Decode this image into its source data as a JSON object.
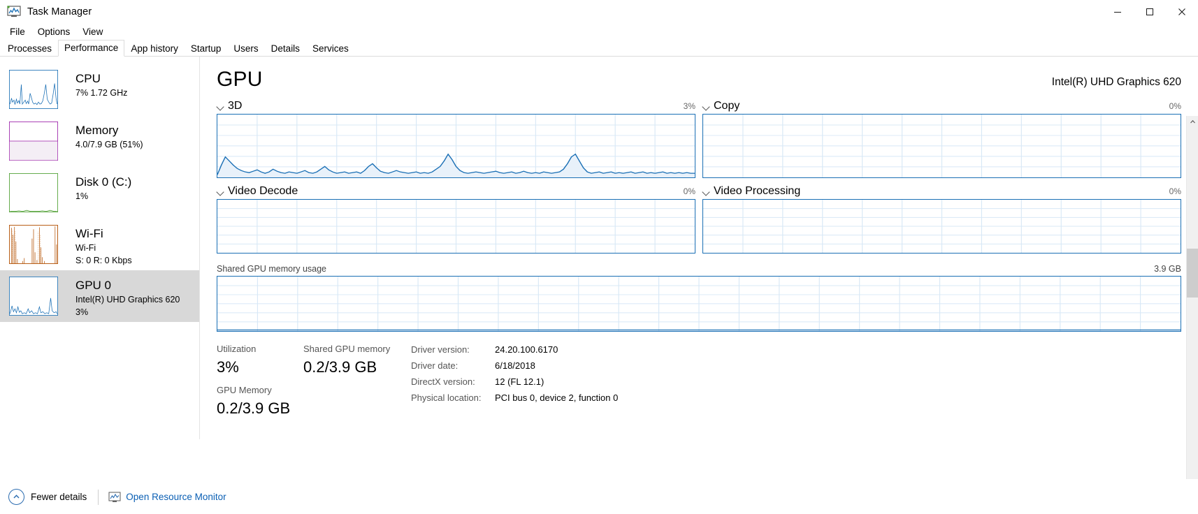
{
  "window": {
    "title": "Task Manager",
    "icon": "task-manager-icon",
    "minimize": "─",
    "maximize": "☐",
    "close": "✕"
  },
  "menu": [
    "File",
    "Options",
    "View"
  ],
  "tabs": [
    {
      "label": "Processes",
      "active": false
    },
    {
      "label": "Performance",
      "active": true
    },
    {
      "label": "App history",
      "active": false
    },
    {
      "label": "Startup",
      "active": false
    },
    {
      "label": "Users",
      "active": false
    },
    {
      "label": "Details",
      "active": false
    },
    {
      "label": "Services",
      "active": false
    }
  ],
  "sidebar": {
    "items": [
      {
        "name": "CPU",
        "title": "CPU",
        "sub1": "7%  1.72 GHz",
        "sub2": "",
        "color": "#1a6fb5",
        "selected": false
      },
      {
        "name": "Memory",
        "title": "Memory",
        "sub1": "4.0/7.9 GB (51%)",
        "sub2": "",
        "color": "#9b1ea8",
        "selected": false
      },
      {
        "name": "Disk 0 (C:)",
        "title": "Disk 0 (C:)",
        "sub1": "1%",
        "sub2": "",
        "color": "#4a9c2d",
        "selected": false
      },
      {
        "name": "Wi-Fi",
        "title": "Wi-Fi",
        "sub1": "Wi-Fi",
        "sub2": "S: 0 R: 0 Kbps",
        "color": "#b85c14",
        "selected": false
      },
      {
        "name": "GPU 0",
        "title": "GPU 0",
        "sub1": "Intel(R) UHD Graphics 620",
        "sub2": "3%",
        "color": "#1a6fb5",
        "selected": true
      }
    ]
  },
  "main": {
    "heading": "GPU",
    "device": "Intel(R) UHD Graphics 620",
    "engines": [
      {
        "label": "3D",
        "percent": "3%"
      },
      {
        "label": "Copy",
        "percent": "0%"
      },
      {
        "label": "Video Decode",
        "percent": "0%"
      },
      {
        "label": "Video Processing",
        "percent": "0%"
      }
    ],
    "memory_graph": {
      "label": "Shared GPU memory usage",
      "max": "3.9 GB"
    },
    "stats": [
      {
        "label": "Utilization",
        "value": "3%"
      },
      {
        "label": "Shared GPU memory",
        "value": "0.2/3.9 GB"
      },
      {
        "label": "GPU Memory",
        "value": "0.2/3.9 GB"
      }
    ],
    "info": [
      {
        "key": "Driver version:",
        "value": "24.20.100.6170"
      },
      {
        "key": "Driver date:",
        "value": "6/18/2018"
      },
      {
        "key": "DirectX version:",
        "value": "12 (FL 12.1)"
      },
      {
        "key": "Physical location:",
        "value": "PCI bus 0, device 2, function 0"
      }
    ]
  },
  "footer": {
    "fewer_details": "Fewer details",
    "open_resource_monitor": "Open Resource Monitor"
  },
  "colors": {
    "accent": "#1a6fb5",
    "link": "#0a5fb4",
    "selected_bg": "#d8d8d8",
    "grid": "#cfe3f3"
  },
  "chart_data": [
    {
      "type": "area",
      "title": "3D",
      "ylim": [
        0,
        100
      ],
      "values": [
        0,
        2,
        14,
        22,
        18,
        14,
        10,
        8,
        6,
        5,
        4,
        5,
        6,
        4,
        3,
        4,
        6,
        9,
        7,
        5,
        4,
        3,
        4,
        5,
        4,
        3,
        3,
        4,
        6,
        8,
        7,
        5,
        4,
        3,
        3,
        4,
        5,
        4,
        3,
        4,
        6,
        9,
        12,
        9,
        6,
        4,
        3,
        3,
        4,
        5,
        6,
        5,
        4,
        3,
        3,
        4,
        5,
        4,
        3,
        3,
        4,
        6,
        8,
        10,
        14,
        22,
        18,
        12,
        8,
        5,
        4,
        3,
        3,
        4,
        5,
        4,
        3,
        3,
        4,
        5,
        6,
        5,
        4,
        3,
        3,
        4,
        5,
        4,
        3,
        4,
        5,
        6,
        4,
        3,
        3,
        4,
        5,
        4,
        3,
        3,
        4,
        6,
        8,
        12,
        18,
        22,
        17,
        12,
        8,
        5,
        4,
        3,
        3,
        4,
        5,
        4,
        3,
        3,
        4,
        3
      ]
    },
    {
      "type": "area",
      "title": "Copy",
      "ylim": [
        0,
        100
      ],
      "values": [
        0,
        0,
        0,
        0,
        0,
        0,
        0,
        0,
        0,
        0,
        0,
        0,
        0,
        0,
        0,
        0,
        0,
        0,
        0,
        0,
        0,
        0,
        0,
        0,
        0,
        0,
        0,
        0,
        0,
        0,
        0,
        0,
        0,
        0,
        0,
        0,
        0,
        0,
        0,
        0
      ]
    },
    {
      "type": "area",
      "title": "Video Decode",
      "ylim": [
        0,
        100
      ],
      "values": [
        0,
        0,
        0,
        0,
        0,
        0,
        0,
        0,
        0,
        0,
        0,
        0,
        0,
        0,
        0,
        0,
        0,
        0,
        0,
        0,
        0,
        0,
        0,
        0,
        0,
        0,
        0,
        0,
        0,
        0,
        0,
        0,
        0,
        0,
        0,
        0,
        0,
        0,
        0,
        0
      ]
    },
    {
      "type": "area",
      "title": "Video Processing",
      "ylim": [
        0,
        100
      ],
      "values": [
        0,
        0,
        0,
        0,
        0,
        0,
        0,
        0,
        0,
        0,
        0,
        0,
        0,
        0,
        0,
        0,
        0,
        0,
        0,
        0,
        0,
        0,
        0,
        0,
        0,
        0,
        0,
        0,
        0,
        0,
        0,
        0,
        0,
        0,
        0,
        0,
        0,
        0,
        0,
        0
      ]
    },
    {
      "type": "area",
      "title": "Shared GPU memory usage",
      "ylabel": "GB",
      "ylim": [
        0,
        3.9
      ],
      "values": [
        0.2,
        0.2,
        0.2,
        0.2,
        0.2,
        0.2,
        0.2,
        0.2,
        0.2,
        0.2,
        0.2,
        0.2,
        0.2,
        0.2,
        0.2,
        0.2,
        0.2,
        0.2,
        0.2,
        0.2,
        0.2,
        0.2,
        0.2,
        0.2,
        0.2,
        0.2,
        0.2,
        0.2,
        0.2,
        0.2,
        0.2,
        0.2,
        0.2,
        0.2,
        0.2,
        0.2,
        0.2,
        0.2,
        0.2,
        0.2
      ]
    },
    {
      "type": "line",
      "title": "CPU sidebar thumbnail",
      "ylim": [
        0,
        100
      ],
      "values": [
        10,
        28,
        14,
        18,
        12,
        10,
        22,
        14,
        10,
        8,
        45,
        14,
        10,
        12,
        16,
        10,
        8,
        12,
        34,
        26,
        16,
        12,
        10,
        8,
        10,
        12,
        9,
        8,
        10,
        12,
        10,
        9,
        8,
        10,
        14,
        30,
        48,
        20,
        12,
        10
      ]
    },
    {
      "type": "line",
      "title": "Wi-Fi sidebar thumbnail",
      "ylim": [
        0,
        100
      ],
      "values": [
        2,
        60,
        4,
        2,
        70,
        2,
        2,
        2,
        2,
        2,
        2,
        2,
        2,
        2,
        2,
        30,
        2,
        2,
        2,
        2,
        65,
        2,
        40,
        2,
        2,
        2,
        2,
        2,
        2,
        2,
        2,
        2,
        2,
        2,
        2,
        2,
        2,
        2,
        2,
        2
      ]
    }
  ]
}
